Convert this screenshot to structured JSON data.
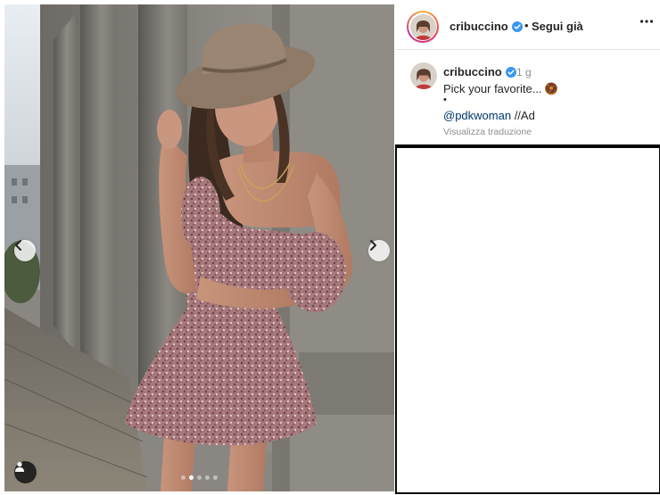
{
  "post": {
    "username": "cribuccino",
    "follow_status": "Segui già",
    "separator": "•",
    "more_icon": "more-horizontal-icon",
    "verified_icon": "verified-badge-icon"
  },
  "caption": {
    "username": "cribuccino",
    "time_ago": "1 g",
    "text": "Pick your favorite...",
    "emoji": "donut-emoji",
    "bullet": "•",
    "mention": "@pdkwoman",
    "mention_suffix": " //Ad",
    "translate_label": "Visualizza traduzione"
  },
  "carousel": {
    "total_slides": 5,
    "active_index": 1,
    "prev_icon": "chevron-left-icon",
    "next_icon": "chevron-right-icon",
    "tag_icon": "user-tag-icon"
  },
  "colors": {
    "text": "#262626",
    "muted": "#8e8e8e",
    "link": "#00376b",
    "verified": "#3897f0"
  }
}
